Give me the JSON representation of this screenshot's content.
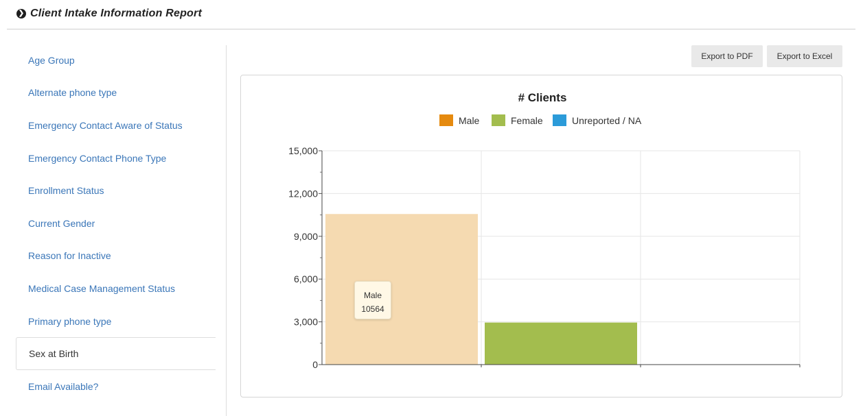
{
  "header": {
    "icon": "circle-arrow-right-icon",
    "title": "Client Intake Information Report"
  },
  "sidebar": {
    "items": [
      {
        "label": "Age Group"
      },
      {
        "label": "Alternate phone type"
      },
      {
        "label": "Emergency Contact Aware of Status"
      },
      {
        "label": "Emergency Contact Phone Type"
      },
      {
        "label": "Enrollment Status"
      },
      {
        "label": "Current Gender"
      },
      {
        "label": "Reason for Inactive"
      },
      {
        "label": "Medical Case Management Status"
      },
      {
        "label": "Primary phone type"
      },
      {
        "label": "Sex at Birth",
        "active": true
      },
      {
        "label": "Email Available?"
      }
    ]
  },
  "toolbar": {
    "export_pdf": "Export to PDF",
    "export_excel": "Export to Excel"
  },
  "tooltip": {
    "category": "Male",
    "value": "10564"
  },
  "chart_data": {
    "type": "bar",
    "title": "# Clients",
    "categories": [
      "Male",
      "Female",
      "Unreported / NA"
    ],
    "values": [
      10564,
      2950,
      0
    ],
    "colors": [
      "#e58a0f",
      "#a3bd4e",
      "#2b9bd9"
    ],
    "hover_colors": [
      "#f5dab1",
      "#a3bd4e",
      "#2b9bd9"
    ],
    "legend": [
      "Male",
      "Female",
      "Unreported / NA"
    ],
    "legend_position": "top",
    "ylim": [
      0,
      15000
    ],
    "yticks": [
      "0",
      "3,000",
      "6,000",
      "9,000",
      "12,000",
      "15,000"
    ],
    "grid": true
  }
}
